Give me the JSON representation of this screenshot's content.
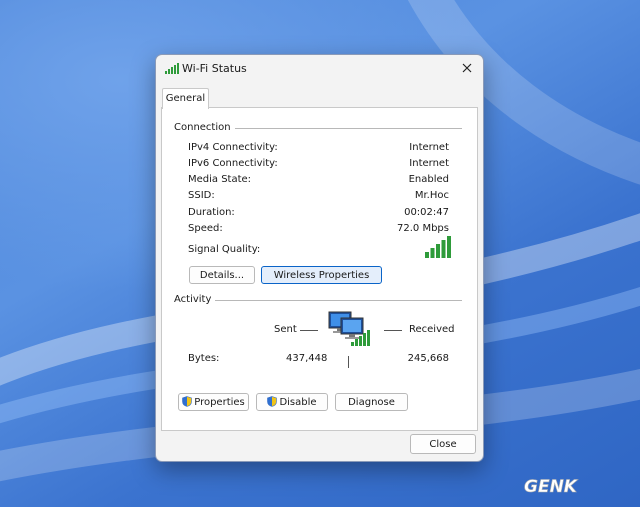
{
  "window": {
    "title": "Wi-Fi Status"
  },
  "tabs": [
    {
      "label": "General"
    }
  ],
  "connection": {
    "header": "Connection",
    "rows": [
      {
        "label": "IPv4 Connectivity:",
        "value": "Internet"
      },
      {
        "label": "IPv6 Connectivity:",
        "value": "Internet"
      },
      {
        "label": "Media State:",
        "value": "Enabled"
      },
      {
        "label": "SSID:",
        "value": "Mr.Hoc"
      },
      {
        "label": "Duration:",
        "value": "00:02:47"
      },
      {
        "label": "Speed:",
        "value": "72.0 Mbps"
      }
    ],
    "signal_label": "Signal Quality:",
    "signal_bars": 5,
    "details_button": "Details...",
    "wireless_button": "Wireless Properties"
  },
  "activity": {
    "header": "Activity",
    "sent_label": "Sent",
    "received_label": "Received",
    "bytes_label": "Bytes:",
    "bytes_sent": "437,448",
    "bytes_received": "245,668"
  },
  "actions": {
    "properties": "Properties",
    "disable": "Disable",
    "diagnose": "Diagnose"
  },
  "footer": {
    "close": "Close"
  },
  "watermark": "GENK",
  "colors": {
    "signal_green": "#2e9b3a",
    "accent_blue": "#0a64c8"
  }
}
